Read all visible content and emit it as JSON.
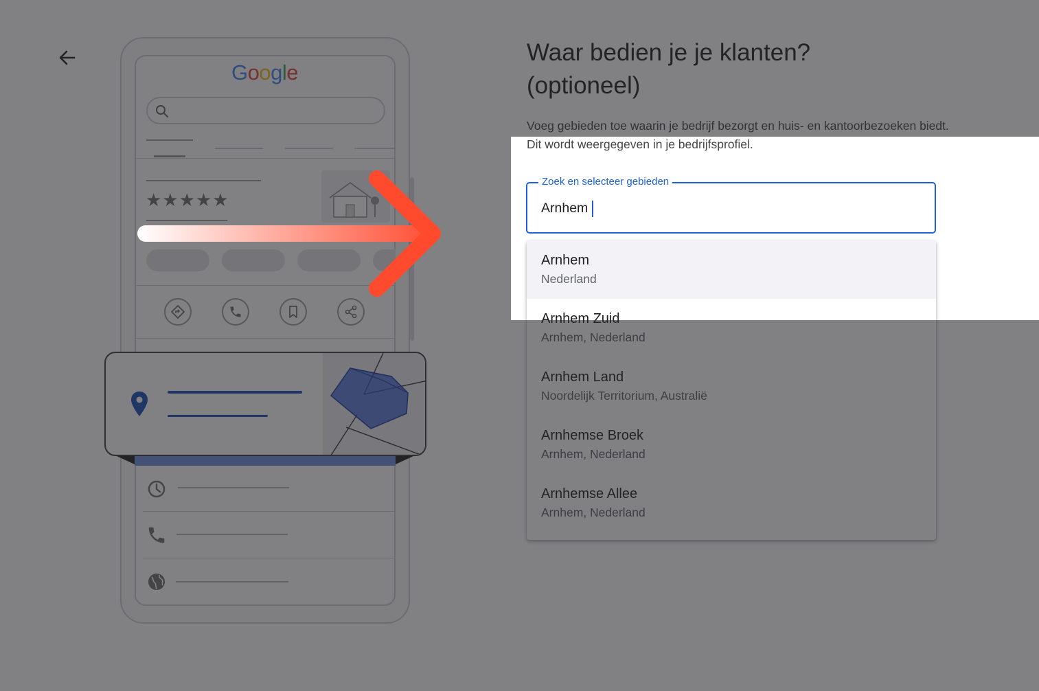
{
  "title_line1": "Waar bedien je je klanten?",
  "title_line2": "(optioneel)",
  "description": "Voeg gebieden toe waarin je bedrijf bezorgt en huis- en kantoorbezoeken biedt. Dit wordt weergegeven in je bedrijfsprofiel.",
  "search": {
    "label": "Zoek en selecteer gebieden",
    "value": "Arnhem"
  },
  "suggestions": [
    {
      "name": "Arnhem",
      "region": "Nederland"
    },
    {
      "name": "Arnhem Zuid",
      "region": "Arnhem, Nederland"
    },
    {
      "name": "Arnhem Land",
      "region": "Noordelijk Territorium, Australië"
    },
    {
      "name": "Arnhemse Broek",
      "region": "Arnhem, Nederland"
    },
    {
      "name": "Arnhemse Allee",
      "region": "Arnhem, Nederland"
    }
  ],
  "illustration": {
    "logo": [
      "G",
      "o",
      "o",
      "g",
      "l",
      "e"
    ],
    "logo_colors": [
      "#4285F4",
      "#EA4335",
      "#FBBC05",
      "#4285F4",
      "#34A853",
      "#EA4335"
    ],
    "stars": "★★★★★",
    "rating_stars": 5
  },
  "colors": {
    "accent": "#1a62d6",
    "arrow_start": "#ffffff",
    "arrow_end": "#ff4a2e"
  },
  "icons": [
    "back-arrow-icon",
    "search-icon",
    "directions-icon",
    "phone-icon",
    "bookmark-icon",
    "share-icon",
    "location-pin-icon",
    "clock-icon",
    "globe-icon"
  ]
}
